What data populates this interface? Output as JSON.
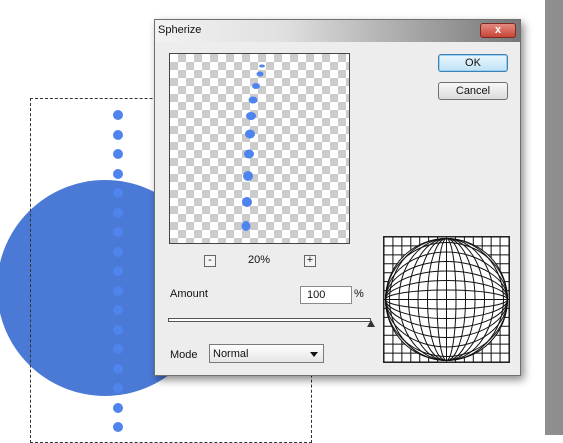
{
  "dialog": {
    "title": "Spherize",
    "close_label": "x",
    "zoom": {
      "minus_label": "-",
      "plus_label": "+",
      "value": "20%"
    },
    "amount": {
      "label": "Amount",
      "value": "100",
      "unit": "%",
      "level_percent": 100
    },
    "mode": {
      "label": "Mode",
      "value": "Normal"
    },
    "buttons": {
      "ok_label": "OK",
      "cancel_label": "Cancel"
    }
  },
  "colors": {
    "dot_blue": "#4f83ee",
    "circle_blue": "#4b79d6",
    "checker_dark": "#cccccc",
    "ok_border": "#3c7fb1"
  },
  "icons": [
    "close-icon",
    "zoom-out-icon",
    "zoom-in-icon",
    "dropdown-arrow-icon",
    "spherize-grid-icon"
  ]
}
